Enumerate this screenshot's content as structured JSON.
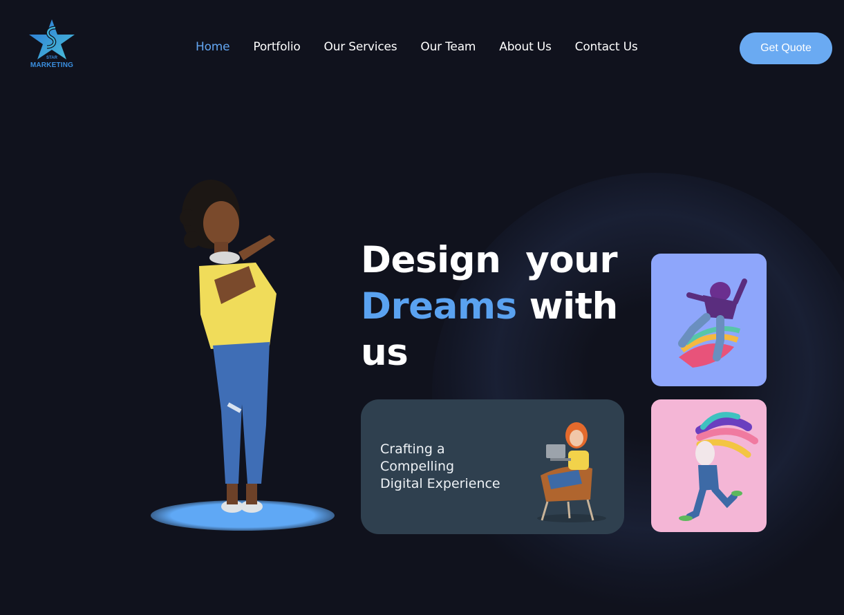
{
  "brand": {
    "logo_top": "STAR",
    "logo_text": "MARKETING"
  },
  "nav": {
    "items": [
      {
        "label": "Home",
        "active": true
      },
      {
        "label": "Portfolio",
        "active": false
      },
      {
        "label": "Our Services",
        "active": false
      },
      {
        "label": "Our Team",
        "active": false
      },
      {
        "label": "About Us",
        "active": false
      },
      {
        "label": "Contact Us",
        "active": false
      }
    ],
    "cta_label": "Get Quote"
  },
  "hero": {
    "line1": "Design  your",
    "accent_word": "Dreams",
    "line2_rest": " with",
    "line3": "us",
    "card_text_1": "Crafting a",
    "card_text_2": "Compelling",
    "card_text_3": "Digital Experience"
  },
  "colors": {
    "background": "#10121d",
    "accent": "#5aa2f0",
    "button": "#6aaaf2",
    "card": "#2f404f",
    "tile_blue": "#8ea6fb",
    "tile_pink": "#f4b6d6"
  },
  "icons": [
    "star-logo-icon",
    "woman-3d-illustration",
    "girl-laptop-chair-illustration",
    "dancing-man-illustration",
    "running-figure-illustration"
  ]
}
